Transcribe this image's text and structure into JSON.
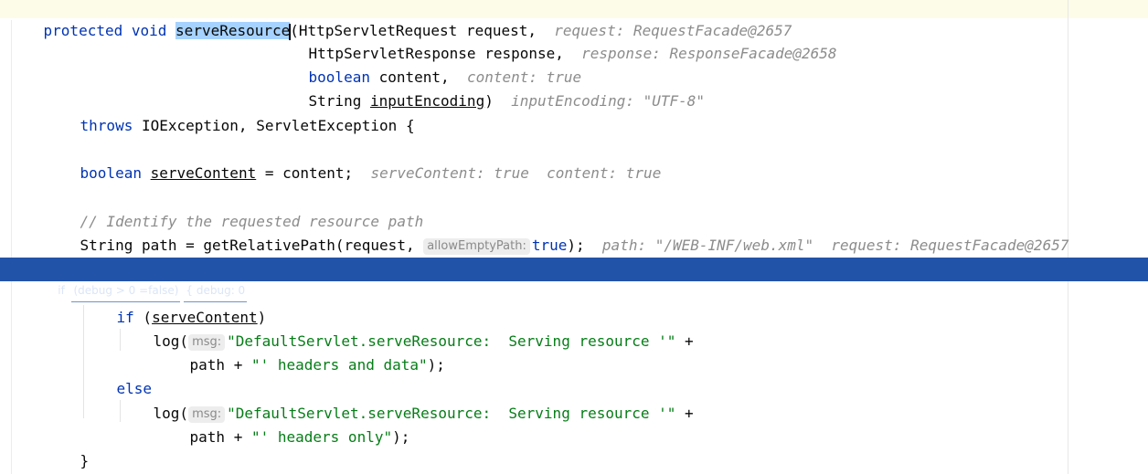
{
  "editor": {
    "lines": {
      "l1": {
        "kw1": "protected",
        "kw2": "void",
        "method": "serveResource",
        "rest": "(HttpServletRequest request,",
        "hint": "request: RequestFacade@2657"
      },
      "l2": {
        "code": "HttpServletResponse response,",
        "hint": "response: ResponseFacade@2658"
      },
      "l3": {
        "kw": "boolean",
        "code": " content,",
        "hint": "content: true"
      },
      "l4": {
        "pre": "String ",
        "var": "inputEncoding",
        "post": ")",
        "hint": "inputEncoding: \"UTF-8\""
      },
      "l5": {
        "kw": "throws",
        "code": " IOException, ServletException {"
      },
      "l6": {
        "kw": "boolean",
        "var": "serveContent",
        "code": " = content;",
        "hint1": "serveContent: true",
        "hint2": "content: true"
      },
      "l7": {
        "comment": "// Identify the requested resource path"
      },
      "l8": {
        "pre": "String path = getRelativePath(request,",
        "param_hint": "allowEmptyPath:",
        "kw": "true",
        "post": ");",
        "hint1": "path: \"/WEB-INF/web.xml\"",
        "hint2": "request: RequestFacade@2657"
      },
      "l9": {
        "if_label": "if",
        "cond": "(debug > 0 =false)",
        "dbg": "{ debug: 0"
      },
      "l10": {
        "kw": "if",
        "pre": " (",
        "var": "serveContent",
        "post": ")"
      },
      "l11": {
        "pre": "log(",
        "param_hint": "msg:",
        "str": "\"DefaultServlet.serveResource:  Serving resource '\"",
        "post": " +"
      },
      "l12": {
        "pre": "path + ",
        "str": "\"' headers and data\"",
        "post": ");"
      },
      "l13": {
        "kw": "else"
      },
      "l14": {
        "pre": "log(",
        "param_hint": "msg:",
        "str": "\"DefaultServlet.serveResource:  Serving resource '\"",
        "post": " +"
      },
      "l15": {
        "pre": "path + ",
        "str": "\"' headers only\"",
        "post": ");"
      },
      "l16": {
        "code": "}"
      }
    },
    "colors": {
      "keyword": "#0033b3",
      "string": "#067d17",
      "comment": "#8c8c8c",
      "execution_line": "#2154a8",
      "selection": "#a6d2ff"
    }
  }
}
